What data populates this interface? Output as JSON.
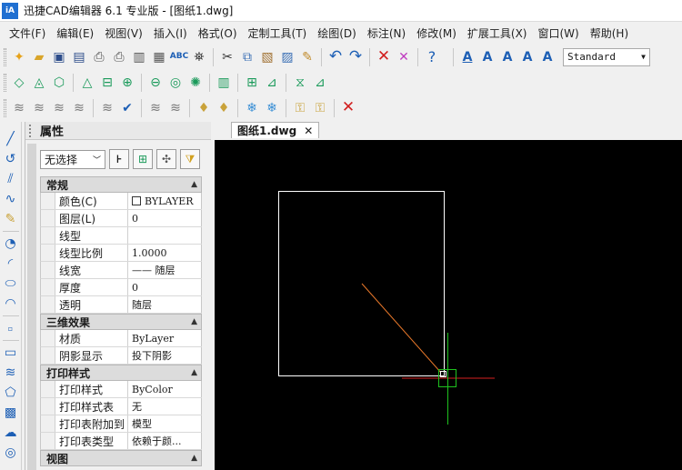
{
  "app": {
    "icon_text": "iA",
    "title": "迅捷CAD编辑器 6.1 专业版  - [图纸1.dwg]"
  },
  "menu": [
    "文件(F)",
    "编辑(E)",
    "视图(V)",
    "插入(I)",
    "格式(O)",
    "定制工具(T)",
    "绘图(D)",
    "标注(N)",
    "修改(M)",
    "扩展工具(X)",
    "窗口(W)",
    "帮助(H)"
  ],
  "toolbar": {
    "text_style_value": "Standard"
  },
  "properties": {
    "title": "属性",
    "selection": "无选择",
    "sections": [
      {
        "title": "常规",
        "rows": [
          {
            "name": "颜色(C)",
            "value": "BYLAYER",
            "swatch": true
          },
          {
            "name": "图层(L)",
            "value": "0"
          },
          {
            "name": "线型",
            "value": ""
          },
          {
            "name": "线型比例",
            "value": "1.0000"
          },
          {
            "name": "线宽",
            "value": "—— 随层"
          },
          {
            "name": "厚度",
            "value": "0"
          },
          {
            "name": "透明",
            "value": "随层"
          }
        ]
      },
      {
        "title": "三维效果",
        "rows": [
          {
            "name": "材质",
            "value": "ByLayer"
          },
          {
            "name": "阴影显示",
            "value": "投下阴影"
          }
        ]
      },
      {
        "title": "打印样式",
        "rows": [
          {
            "name": "打印样式",
            "value": "ByColor"
          },
          {
            "name": "打印样式表",
            "value": "无"
          },
          {
            "name": "打印表附加到",
            "value": "模型"
          },
          {
            "name": "打印表类型",
            "value": "依赖于颜..."
          }
        ]
      },
      {
        "title": "视图",
        "rows": []
      }
    ]
  },
  "document": {
    "tab_label": "图纸1.dwg",
    "tab_close": "✕"
  },
  "colors": {
    "canvas_bg": "#000000",
    "rect": "#ffffff",
    "line": "#e8782a",
    "crosshair_h": "#d61f1f",
    "crosshair_v": "#1fc21f",
    "cursor_box": "#1fc21f"
  }
}
